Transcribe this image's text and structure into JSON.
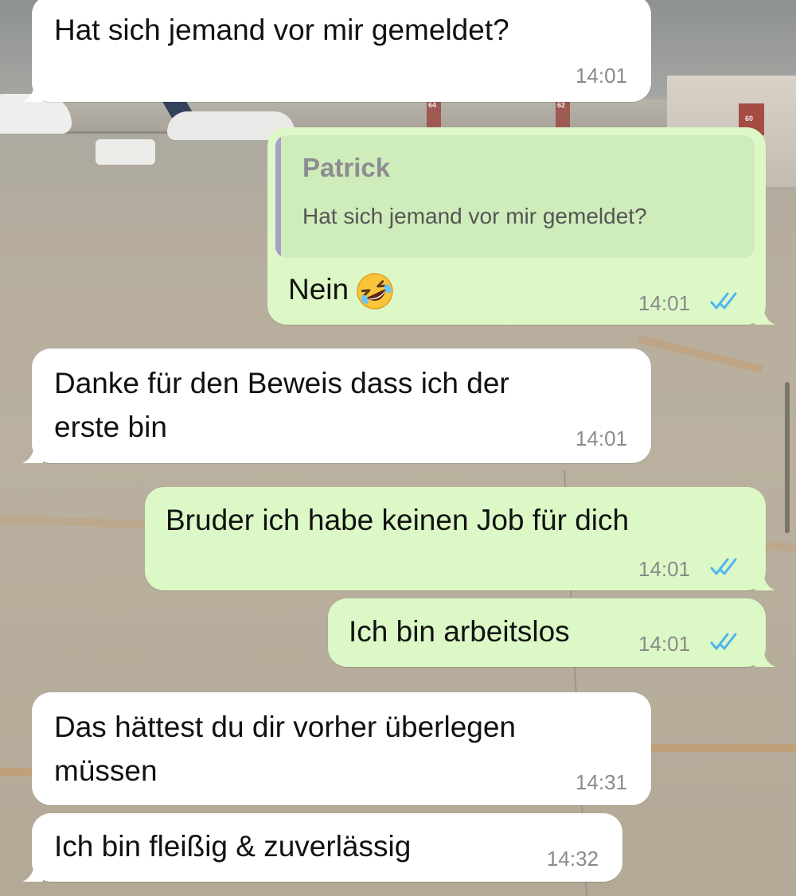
{
  "messages": [
    {
      "id": "m1",
      "direction": "incoming",
      "text": "Hat sich jemand vor mir gemeldet?",
      "time": "14:01"
    },
    {
      "id": "m2",
      "direction": "outgoing",
      "reply_to": {
        "sender": "Patrick",
        "text": "Hat sich jemand vor mir gemeldet?"
      },
      "text": "Nein",
      "emoji": "rolling-on-the-floor-laughing-emoji",
      "time": "14:01",
      "status": "read"
    },
    {
      "id": "m3",
      "direction": "incoming",
      "text_lines": [
        "Danke für den Beweis dass ich der",
        "erste bin"
      ],
      "time": "14:01"
    },
    {
      "id": "m4",
      "direction": "outgoing",
      "text": "Bruder ich habe keinen Job für dich",
      "time": "14:01",
      "status": "read"
    },
    {
      "id": "m5",
      "direction": "outgoing",
      "text": "Ich bin arbeitslos",
      "time": "14:01",
      "status": "read"
    },
    {
      "id": "m6",
      "direction": "incoming",
      "text_lines": [
        "Das hättest du dir vorher überlegen",
        "müssen"
      ],
      "time": "14:31"
    },
    {
      "id": "m7",
      "direction": "incoming",
      "text": "Ich bin fleißig & zuverlässig",
      "time": "14:32"
    }
  ],
  "colors": {
    "incoming_bubble": "#ffffff",
    "outgoing_bubble": "#dcf8c6",
    "quote_background": "#cfecbb",
    "quote_bar": "#a89ec9",
    "read_ticks": "#4fb4f0",
    "timestamp": "#8a8a8a"
  },
  "background": {
    "type": "photo-wallpaper",
    "subject": "airport-apron",
    "gate_numbers": [
      "64",
      "62",
      "60"
    ]
  }
}
